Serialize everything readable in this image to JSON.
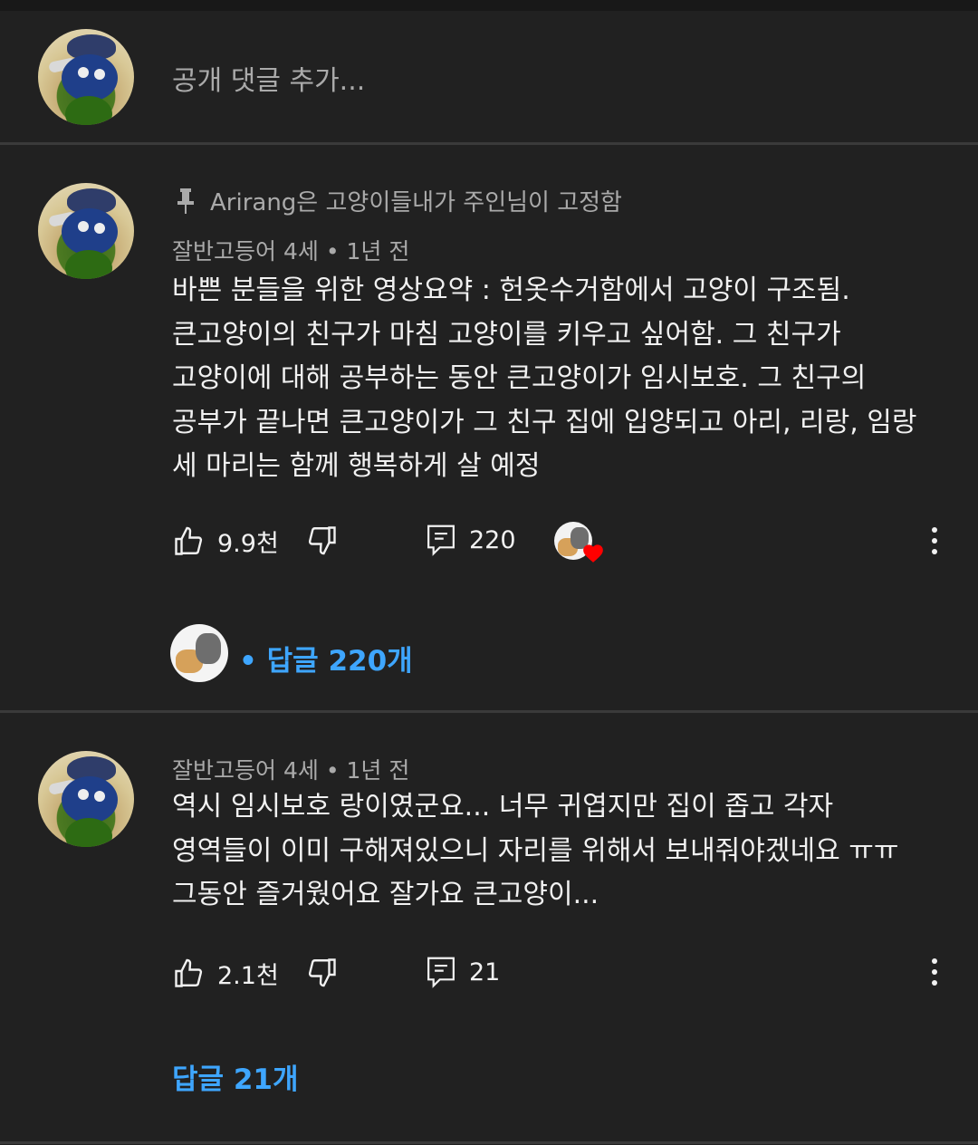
{
  "composer": {
    "placeholder": "공개 댓글 추가..."
  },
  "comments": [
    {
      "pinned_text": "Arirang은 고양이들내가 주인님이 고정함",
      "author": "잘반고등어 4세",
      "time": "1년 전",
      "text": "바쁜 분들을 위한 영상요약 : 헌옷수거함에서 고양이 구조됨.\n큰고양이의 친구가 마침 고양이를 키우고 싶어함. 그 친구가\n고양이에 대해 공부하는 동안 큰고양이가 임시보호. 그 친구의\n공부가 끝나면 큰고양이가 그 친구 집에 입양되고 아리, 리랑, 임랑\n세 마리는 함께 행복하게 살 예정",
      "likes": "9.9천",
      "reply_count": "220",
      "replies_link": "• 답글 220개"
    },
    {
      "author": "잘반고등어 4세",
      "time": "1년 전",
      "text": "역시 임시보호 랑이였군요... 너무 귀엽지만 집이 좁고 각자\n영역들이 이미 구해져있으니 자리를 위해서 보내줘야겠네요 ㅠㅠ\n그동안 즐거웠어요 잘가요 큰고양이...",
      "likes": "2.1천",
      "reply_count": "21",
      "replies_link": "답글 21개"
    }
  ],
  "separator": "•",
  "colors": {
    "background": "#212121",
    "link": "#3ea6ff",
    "muted": "#aaaaaa",
    "heart": "#ff0000"
  },
  "icons": [
    "pin-icon",
    "thumbs-up-icon",
    "thumbs-down-icon",
    "reply-icon",
    "more-vert-icon",
    "creator-heart-icon"
  ]
}
